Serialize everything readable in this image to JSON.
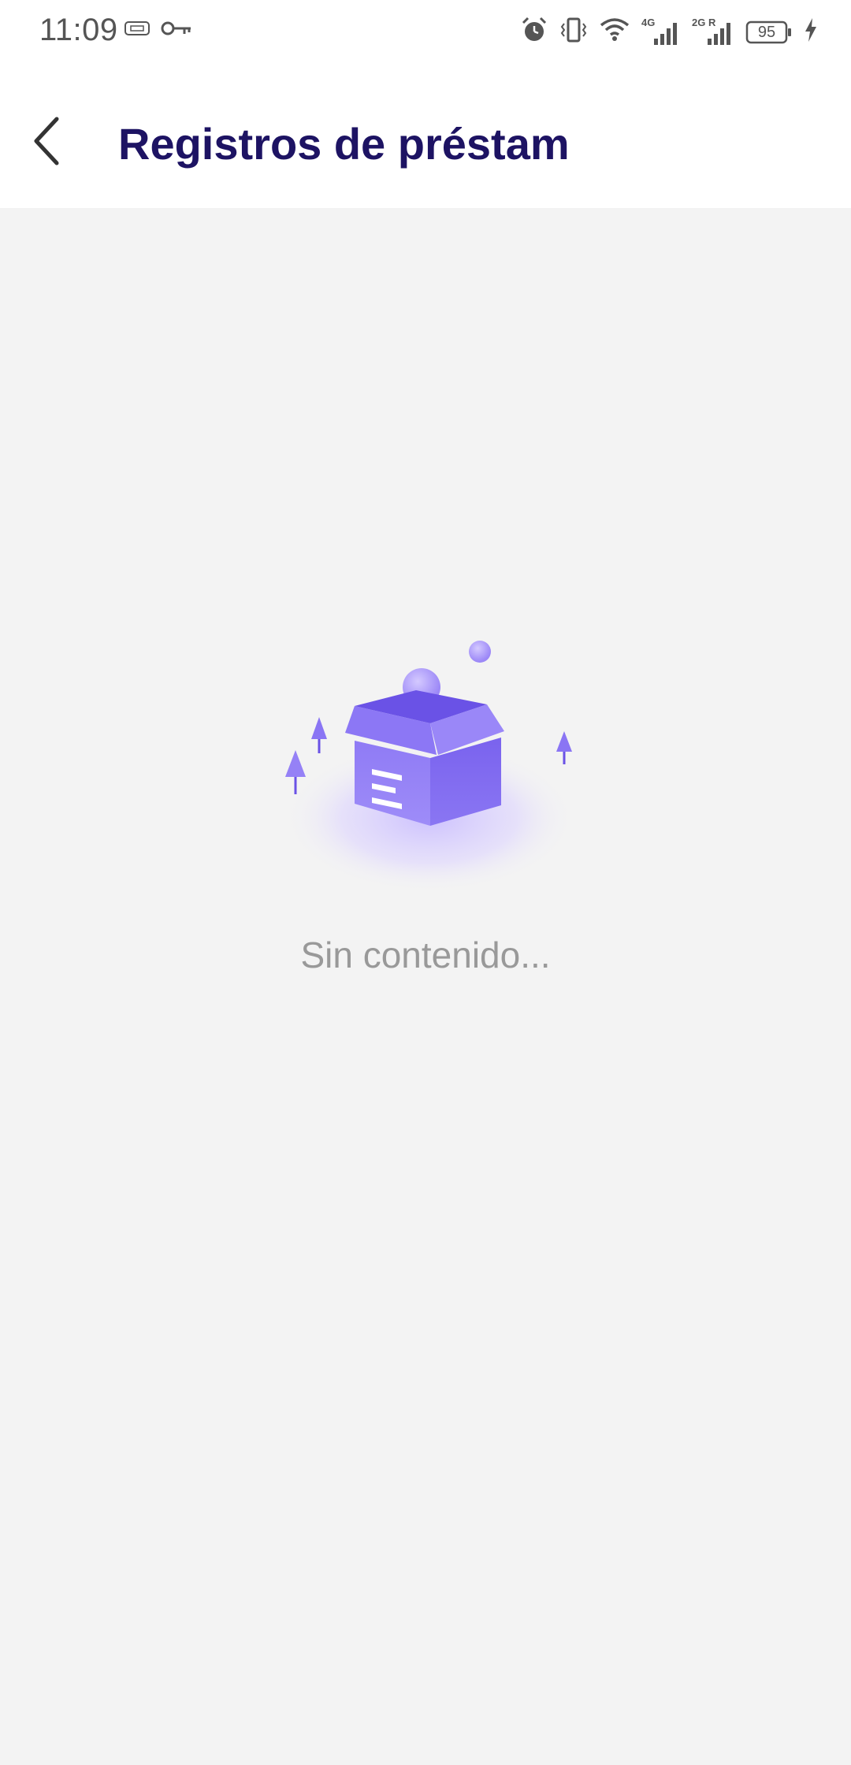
{
  "status_bar": {
    "time": "11:09",
    "battery": "95",
    "network_1": "4G",
    "network_2": "2G R",
    "icons": [
      "sim-card-icon",
      "vpn-key-icon",
      "alarm-icon",
      "vibrate-icon",
      "wifi-icon",
      "signal-4g-icon",
      "signal-2g-icon",
      "battery-icon",
      "charging-icon"
    ]
  },
  "header": {
    "title": "Registros de préstam",
    "back_icon": "chevron-left-icon"
  },
  "empty_state": {
    "illustration": "empty-box-illustration",
    "message": "Sin contenido..."
  },
  "colors": {
    "title": "#1d1363",
    "accent": "#7b63f0",
    "background": "#f3f3f3",
    "empty_text": "#999999"
  }
}
